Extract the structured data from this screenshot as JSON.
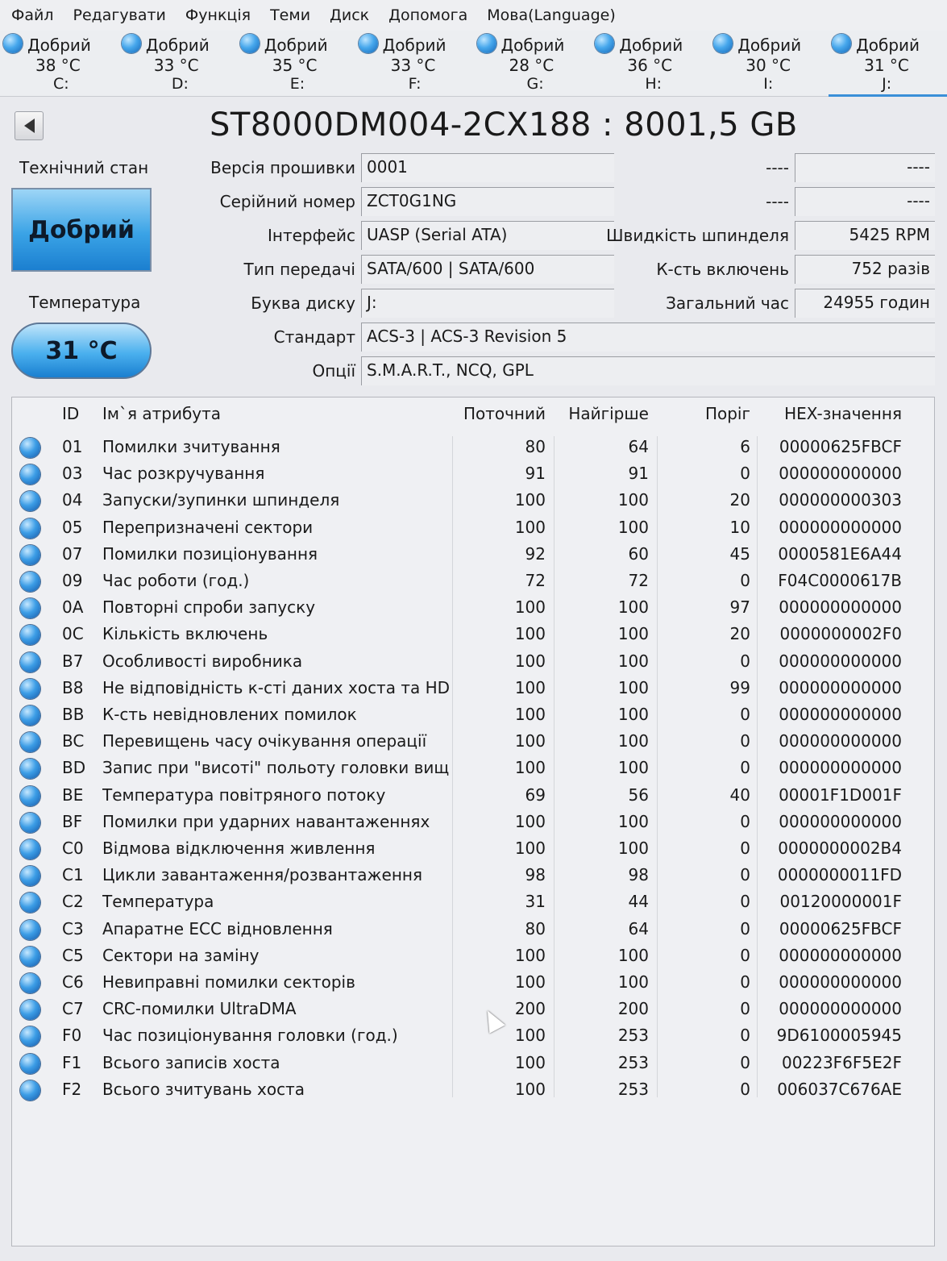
{
  "menu": [
    "Файл",
    "Редагувати",
    "Функція",
    "Теми",
    "Диск",
    "Допомога",
    "Мова(Language)"
  ],
  "drives": [
    {
      "status": "Добрий",
      "temp": "38 °C",
      "letter": "C:"
    },
    {
      "status": "Добрий",
      "temp": "33 °C",
      "letter": "D:"
    },
    {
      "status": "Добрий",
      "temp": "35 °C",
      "letter": "E:"
    },
    {
      "status": "Добрий",
      "temp": "33 °C",
      "letter": "F:"
    },
    {
      "status": "Добрий",
      "temp": "28 °C",
      "letter": "G:"
    },
    {
      "status": "Добрий",
      "temp": "36 °C",
      "letter": "H:"
    },
    {
      "status": "Добрий",
      "temp": "30 °C",
      "letter": "I:"
    },
    {
      "status": "Добрий",
      "temp": "31 °C",
      "letter": "J:"
    }
  ],
  "active_drive": "J:",
  "disk_title": "ST8000DM004-2CX188 : 8001,5 GB",
  "health": {
    "label": "Технічний стан",
    "value": "Добрий"
  },
  "temperature": {
    "label": "Температура",
    "value": "31 °C"
  },
  "info": {
    "firmware": {
      "label": "Версія прошивки",
      "value": "0001"
    },
    "serial": {
      "label": "Серійний номер",
      "value": "ZCT0G1NG"
    },
    "interface": {
      "label": "Інтерфейс",
      "value": "UASP (Serial ATA)"
    },
    "transfer": {
      "label": "Тип передачі",
      "value": "SATA/600 | SATA/600"
    },
    "letter": {
      "label": "Буква диску",
      "value": "J:"
    },
    "standard": {
      "label": "Стандарт",
      "value": "ACS-3 | ACS-3 Revision 5"
    },
    "options": {
      "label": "Опції",
      "value": "S.M.A.R.T., NCQ, GPL"
    },
    "blank1": {
      "label": "----",
      "value": "----"
    },
    "blank2": {
      "label": "----",
      "value": "----"
    },
    "rpm": {
      "label": "Швидкість шпинделя",
      "value": "5425 RPM"
    },
    "power_on_count": {
      "label": "К-сть включень",
      "value": "752 разів"
    },
    "power_on_hours": {
      "label": "Загальний час",
      "value": "24955 годин"
    }
  },
  "table": {
    "headers": {
      "id": "ID",
      "name": "Ім`я атрибута",
      "current": "Поточний",
      "worst": "Найгірше",
      "threshold": "Поріг",
      "hex": "HEX-значення"
    },
    "rows": [
      {
        "id": "01",
        "name": "Помилки зчитування",
        "current": "80",
        "worst": "64",
        "threshold": "6",
        "hex": "00000625FBCF"
      },
      {
        "id": "03",
        "name": "Час розкручування",
        "current": "91",
        "worst": "91",
        "threshold": "0",
        "hex": "000000000000"
      },
      {
        "id": "04",
        "name": "Запуски/зупинки шпинделя",
        "current": "100",
        "worst": "100",
        "threshold": "20",
        "hex": "000000000303"
      },
      {
        "id": "05",
        "name": "Перепризначені сектори",
        "current": "100",
        "worst": "100",
        "threshold": "10",
        "hex": "000000000000"
      },
      {
        "id": "07",
        "name": "Помилки позиціонування",
        "current": "92",
        "worst": "60",
        "threshold": "45",
        "hex": "0000581E6A44"
      },
      {
        "id": "09",
        "name": "Час роботи (год.)",
        "current": "72",
        "worst": "72",
        "threshold": "0",
        "hex": "F04C0000617B"
      },
      {
        "id": "0A",
        "name": "Повторні спроби запуску",
        "current": "100",
        "worst": "100",
        "threshold": "97",
        "hex": "000000000000"
      },
      {
        "id": "0C",
        "name": "Кількість включень",
        "current": "100",
        "worst": "100",
        "threshold": "20",
        "hex": "0000000002F0"
      },
      {
        "id": "B7",
        "name": "Особливості виробника",
        "current": "100",
        "worst": "100",
        "threshold": "0",
        "hex": "000000000000"
      },
      {
        "id": "B8",
        "name": "Не відповідність к-сті даних хоста та HDD",
        "current": "100",
        "worst": "100",
        "threshold": "99",
        "hex": "000000000000"
      },
      {
        "id": "BB",
        "name": "К-сть невідновлених помилок",
        "current": "100",
        "worst": "100",
        "threshold": "0",
        "hex": "000000000000"
      },
      {
        "id": "BC",
        "name": "Перевищень часу очікування операції",
        "current": "100",
        "worst": "100",
        "threshold": "0",
        "hex": "000000000000"
      },
      {
        "id": "BD",
        "name": "Запис при \"висоті\" польоту головки вище ...",
        "current": "100",
        "worst": "100",
        "threshold": "0",
        "hex": "000000000000"
      },
      {
        "id": "BE",
        "name": "Температура повітряного потоку",
        "current": "69",
        "worst": "56",
        "threshold": "40",
        "hex": "00001F1D001F"
      },
      {
        "id": "BF",
        "name": "Помилки при ударних навантаженнях",
        "current": "100",
        "worst": "100",
        "threshold": "0",
        "hex": "000000000000"
      },
      {
        "id": "C0",
        "name": "Відмова відключення живлення",
        "current": "100",
        "worst": "100",
        "threshold": "0",
        "hex": "0000000002B4"
      },
      {
        "id": "C1",
        "name": "Цикли завантаження/розвантаження",
        "current": "98",
        "worst": "98",
        "threshold": "0",
        "hex": "0000000011FD"
      },
      {
        "id": "C2",
        "name": "Температура",
        "current": "31",
        "worst": "44",
        "threshold": "0",
        "hex": "00120000001F"
      },
      {
        "id": "C3",
        "name": "Апаратне ECC відновлення",
        "current": "80",
        "worst": "64",
        "threshold": "0",
        "hex": "00000625FBCF"
      },
      {
        "id": "C5",
        "name": "Сектори на заміну",
        "current": "100",
        "worst": "100",
        "threshold": "0",
        "hex": "000000000000"
      },
      {
        "id": "C6",
        "name": "Невиправні помилки секторів",
        "current": "100",
        "worst": "100",
        "threshold": "0",
        "hex": "000000000000"
      },
      {
        "id": "C7",
        "name": "CRC-помилки UltraDMA",
        "current": "200",
        "worst": "200",
        "threshold": "0",
        "hex": "000000000000"
      },
      {
        "id": "F0",
        "name": "Час позиціонування головки (год.)",
        "current": "100",
        "worst": "253",
        "threshold": "0",
        "hex": "9D6100005945"
      },
      {
        "id": "F1",
        "name": "Всього записів хоста",
        "current": "100",
        "worst": "253",
        "threshold": "0",
        "hex": "00223F6F5E2F"
      },
      {
        "id": "F2",
        "name": "Всього зчитувань хоста",
        "current": "100",
        "worst": "253",
        "threshold": "0",
        "hex": "006037C676AE"
      }
    ]
  },
  "colors": {
    "status_good": "#3aa3e6",
    "background": "#e9eaee"
  },
  "icons": {
    "back": "back-arrow-icon",
    "status": "status-dot-icon"
  }
}
